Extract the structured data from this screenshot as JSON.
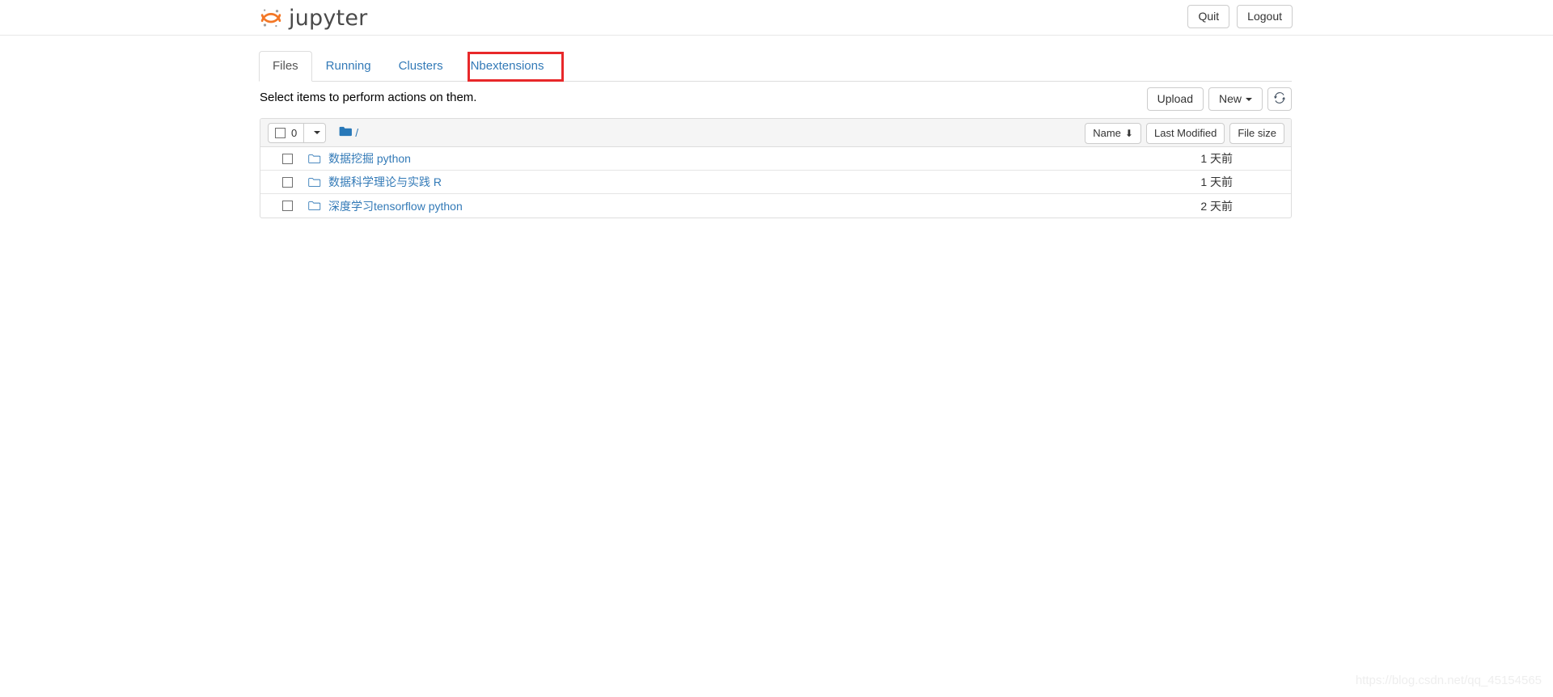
{
  "header": {
    "brand_text": "jupyter",
    "logo_icon": "jupyter-logo",
    "quit_label": "Quit",
    "logout_label": "Logout"
  },
  "tabs": [
    {
      "label": "Files",
      "active": true
    },
    {
      "label": "Running",
      "active": false
    },
    {
      "label": "Clusters",
      "active": false
    },
    {
      "label": "Nbextensions",
      "active": false,
      "annotated": true
    }
  ],
  "annotation": {
    "color": "#e8282a",
    "target": "Nbextensions"
  },
  "actions": {
    "select_note": "Select items to perform actions on them.",
    "upload_label": "Upload",
    "new_label": "New",
    "refresh_icon": "refresh-icon"
  },
  "filelist": {
    "select_all_count": "0",
    "breadcrumb_root": "/",
    "folder_icon": "folder-icon",
    "sort": {
      "name_label": "Name",
      "name_sort_arrow": "⬇",
      "last_modified_label": "Last Modified",
      "file_size_label": "File size"
    },
    "rows": [
      {
        "name": "数据挖掘 python",
        "modified": "1 天前",
        "size": ""
      },
      {
        "name": "数据科学理论与实践 R",
        "modified": "1 天前",
        "size": ""
      },
      {
        "name": "深度学习tensorflow python",
        "modified": "2 天前",
        "size": ""
      }
    ]
  },
  "watermark": {
    "text": "https://blog.csdn.net/qq_45154565"
  },
  "colors": {
    "link": "#337ab7",
    "logo_orange": "#f37726",
    "folder_blue": "#2878b8",
    "annotation_red": "#e8282a"
  }
}
